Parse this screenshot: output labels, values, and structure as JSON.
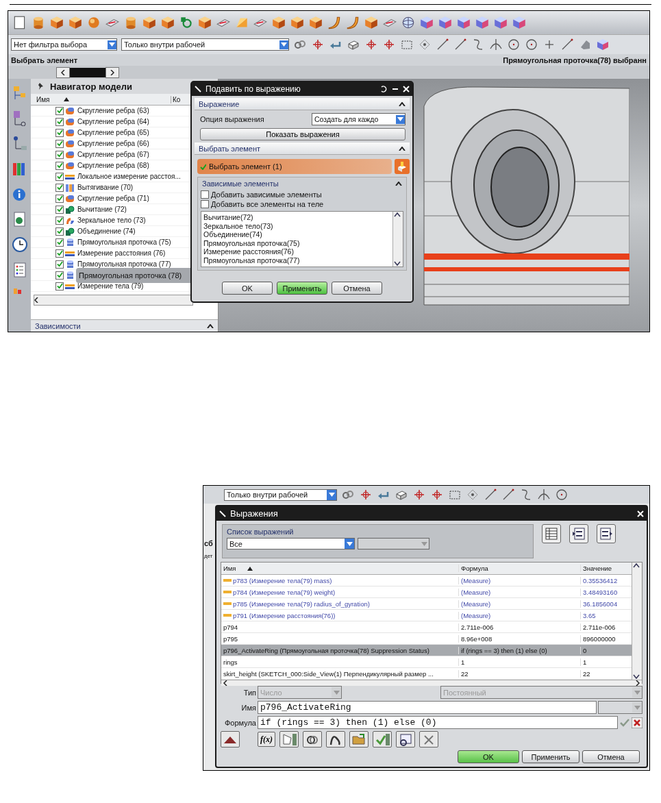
{
  "screen_1": {
    "filter_dropdowns": [
      {
        "value": "Нет фильтра выбора"
      },
      {
        "value": "Только внутри рабочей"
      }
    ],
    "prompt": "Выбрать элемент",
    "status": "Прямоугольная проточка(78) выбранн",
    "navigator": {
      "title": "Навигатор модели",
      "columns": [
        "Имя",
        "Ко"
      ],
      "rows": [
        {
          "label": "Скругление ребра (63)",
          "kind": "blend",
          "checked": true,
          "selected": false
        },
        {
          "label": "Скругление ребра (64)",
          "kind": "blend",
          "checked": true,
          "selected": false
        },
        {
          "label": "Скругление ребра (65)",
          "kind": "blend",
          "checked": true,
          "selected": false
        },
        {
          "label": "Скругление ребра (66)",
          "kind": "blend",
          "checked": true,
          "selected": false
        },
        {
          "label": "Скругление ребра (67)",
          "kind": "blend",
          "checked": true,
          "selected": false
        },
        {
          "label": "Скругление ребра (68)",
          "kind": "blend",
          "checked": true,
          "selected": false
        },
        {
          "label": "Локальное измерение расстоя...",
          "kind": "measure",
          "checked": true,
          "selected": false
        },
        {
          "label": "Вытягивание (70)",
          "kind": "extrude",
          "checked": true,
          "selected": false
        },
        {
          "label": "Скругление ребра (71)",
          "kind": "blend",
          "checked": true,
          "selected": false
        },
        {
          "label": "Вычитание (72)",
          "kind": "boolean",
          "checked": true,
          "selected": false
        },
        {
          "label": "Зеркальное тело (73)",
          "kind": "mirror",
          "checked": true,
          "selected": false
        },
        {
          "label": "Объединение (74)",
          "kind": "boolean",
          "checked": true,
          "selected": false
        },
        {
          "label": "Прямоугольная проточка (75)",
          "kind": "groove",
          "checked": true,
          "selected": false
        },
        {
          "label": "Измерение расстояния (76)",
          "kind": "measure",
          "checked": true,
          "selected": false
        },
        {
          "label": "Прямоугольная проточка (77)",
          "kind": "groove",
          "checked": true,
          "selected": false
        },
        {
          "label": "Прямоугольная проточка (78)",
          "kind": "groove",
          "checked": true,
          "selected": true
        },
        {
          "label": "Измерение тела (79)",
          "kind": "measure",
          "checked": true,
          "selected": false
        }
      ],
      "dependencies_title": "Зависимости"
    },
    "dialog": {
      "title": "Подавить по выражению",
      "expression_section": {
        "title": "Выражение",
        "option_label": "Опция выражения",
        "option_value": "Создать для каждо",
        "show_button": "Показать выражения"
      },
      "select_section": {
        "title": "Выбрать элемент",
        "selection": {
          "label": "Выбрать элемент (1)",
          "complete": true
        },
        "dependent": {
          "title": "Зависимые элементы",
          "options": [
            {
              "label": "Добавить зависимые элементы",
              "checked": false
            },
            {
              "label": "Добавить все элементы на теле",
              "checked": false
            }
          ],
          "list": [
            "Вычитание(72)",
            "Зеркальное тело(73)",
            "Объединение(74)",
            "Прямоугольная проточка(75)",
            "Измерение расстояния(76)",
            "Прямоугольная проточка(77)"
          ]
        }
      },
      "buttons": [
        {
          "label": "OK",
          "default": false
        },
        {
          "label": "Применить",
          "default": true
        },
        {
          "label": "Отмена",
          "default": false
        }
      ]
    }
  },
  "screen_2": {
    "background": {
      "dropdown": "Только внутри рабочей",
      "texts": [
        "сб",
        "дет"
      ]
    },
    "dialog": {
      "title": "Выражения",
      "list_group": {
        "title": "Список выражений",
        "filter": "Все"
      },
      "table": {
        "columns": [
          "Имя",
          "Формула",
          "Значение"
        ],
        "rows": [
          {
            "kind": "measure",
            "name": "p783  (Измерение тела(79) mass)",
            "formula": "(Measure)",
            "value": "0.35536412",
            "selected": false
          },
          {
            "kind": "measure",
            "name": "p784  (Измерение тела(79) weight)",
            "formula": "(Measure)",
            "value": "3.48493160",
            "selected": false
          },
          {
            "kind": "measure",
            "name": "p785  (Измерение тела(79) radius_of_gyration)",
            "formula": "(Measure)",
            "value": "36.1856004",
            "selected": false
          },
          {
            "kind": "measure",
            "name": "p791  (Измерение расстояния(76))",
            "formula": "(Measure)",
            "value": "3.65",
            "selected": false
          },
          {
            "kind": "user",
            "name": "p794",
            "formula": "2.711e-006",
            "value": "2.711e-006",
            "selected": false
          },
          {
            "kind": "user",
            "name": "p795",
            "formula": "8.96e+008",
            "value": "896000000",
            "selected": false
          },
          {
            "kind": "user",
            "name": "p796_ActivateRing  (Прямоугольная проточка(78) Suppression Status)",
            "formula": "if (rings == 3) then (1) else (0)",
            "value": "0",
            "selected": true
          },
          {
            "kind": "user",
            "name": "rings",
            "formula": "1",
            "value": "1",
            "selected": false
          },
          {
            "kind": "user",
            "name": "skirt_height  (SKETCH_000:Side_View(1) Перпендикулярный размер ...",
            "formula": "22",
            "value": "22",
            "selected": false
          }
        ]
      },
      "type": {
        "label": "Тип",
        "value": "Число",
        "mode": "Постоянный"
      },
      "name": {
        "label": "Имя",
        "value": "p796_ActivateRing"
      },
      "formula": {
        "label": "Формула",
        "value": "if (rings == 3) then (1) else (0)"
      },
      "function_button": "f(x)",
      "buttons": [
        {
          "label": "OK",
          "default": true
        },
        {
          "label": "Применить",
          "default": false
        },
        {
          "label": "Отмена",
          "default": false
        }
      ]
    }
  }
}
